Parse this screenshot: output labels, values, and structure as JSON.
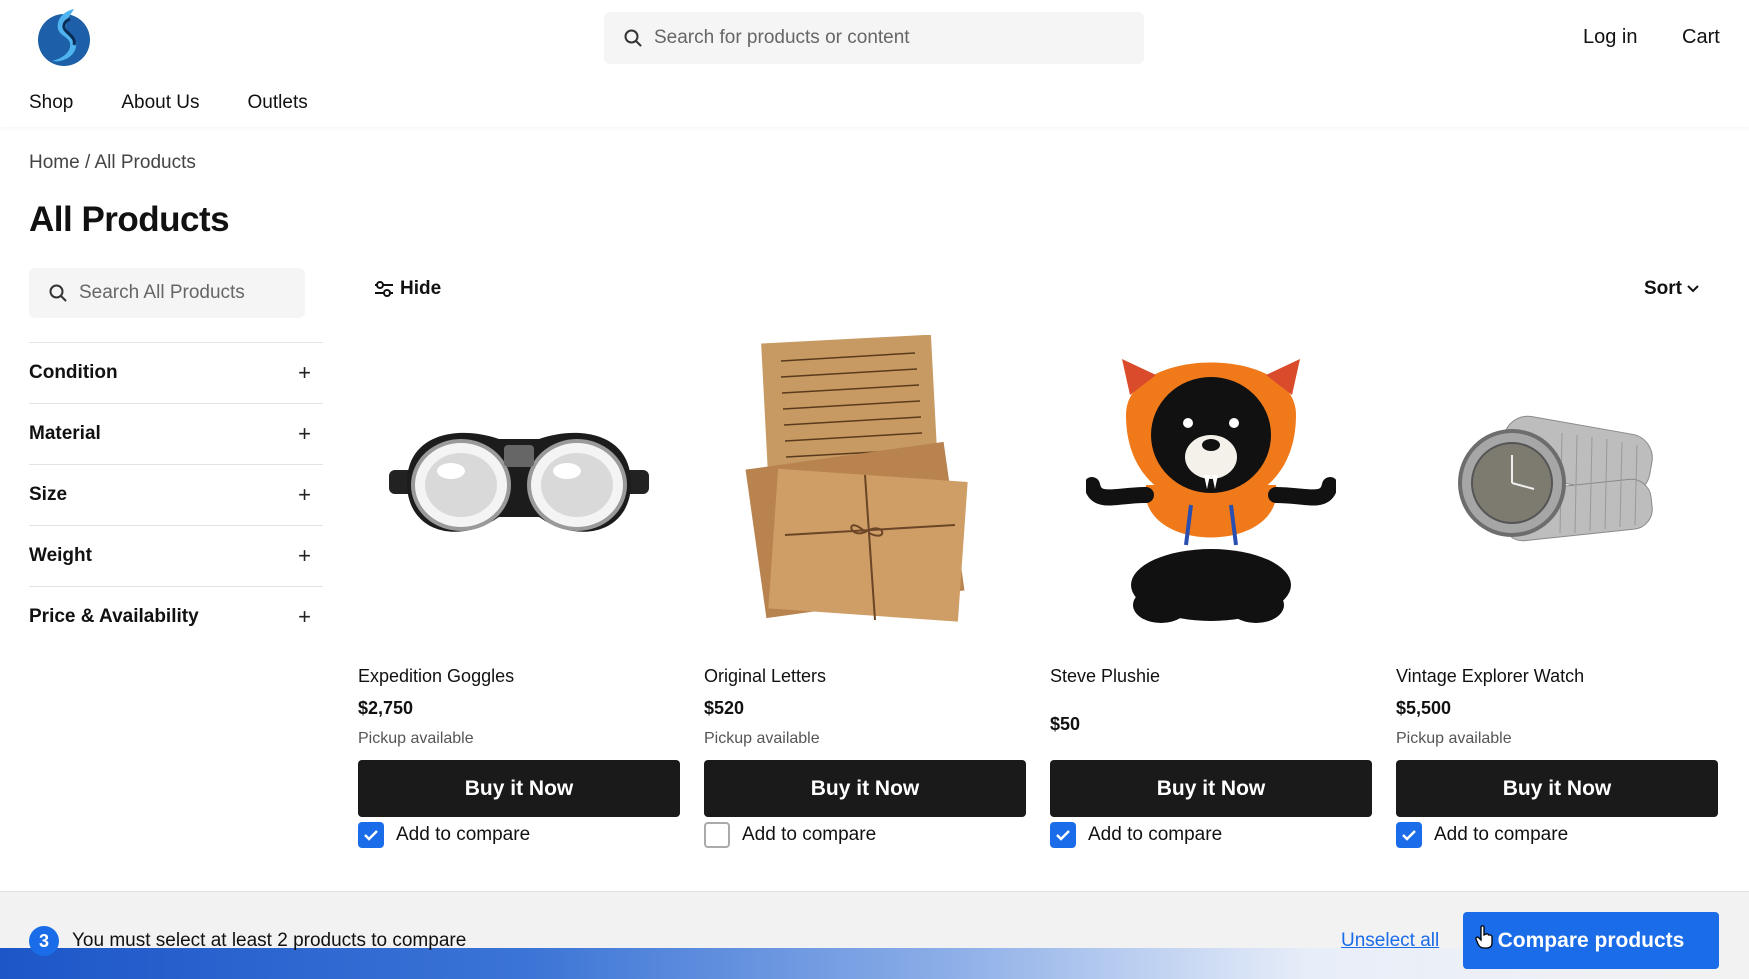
{
  "header": {
    "logo": "brand-logo",
    "search_placeholder": "Search for products or content",
    "login": "Log in",
    "cart": "Cart",
    "nav": [
      "Shop",
      "About Us",
      "Outlets"
    ]
  },
  "breadcrumb": {
    "home": "Home",
    "sep": " / ",
    "current": "All Products"
  },
  "page_title": "All Products",
  "sidebar": {
    "search_placeholder": "Search All Products",
    "filters": [
      "Condition",
      "Material",
      "Size",
      "Weight",
      "Price & Availability"
    ],
    "expand_glyph": "+"
  },
  "toolbar": {
    "hide": "Hide",
    "sort": "Sort"
  },
  "products": [
    {
      "name": "Expedition Goggles",
      "price": "$2,750",
      "pickup": "Pickup available",
      "buy": "Buy it Now",
      "compare": "Add to compare",
      "checked": true,
      "image": "goggles"
    },
    {
      "name": "Original Letters",
      "price": "$520",
      "pickup": "Pickup available",
      "buy": "Buy it Now",
      "compare": "Add to compare",
      "checked": false,
      "image": "letters"
    },
    {
      "name": "Steve Plushie",
      "price": "$50",
      "pickup": "",
      "buy": "Buy it Now",
      "compare": "Add to compare",
      "checked": true,
      "image": "plushie"
    },
    {
      "name": "Vintage Explorer Watch",
      "price": "$5,500",
      "pickup": "Pickup available",
      "buy": "Buy it Now",
      "compare": "Add to compare",
      "checked": true,
      "image": "watch"
    }
  ],
  "compare_bar": {
    "count": "3",
    "message": "You must select at least 2 products to compare",
    "unselect": "Unselect all",
    "button": "Compare products"
  },
  "colors": {
    "accent": "#1a6ce8",
    "button_dark": "#1a1a1a",
    "logo": "#1d5fa8"
  }
}
